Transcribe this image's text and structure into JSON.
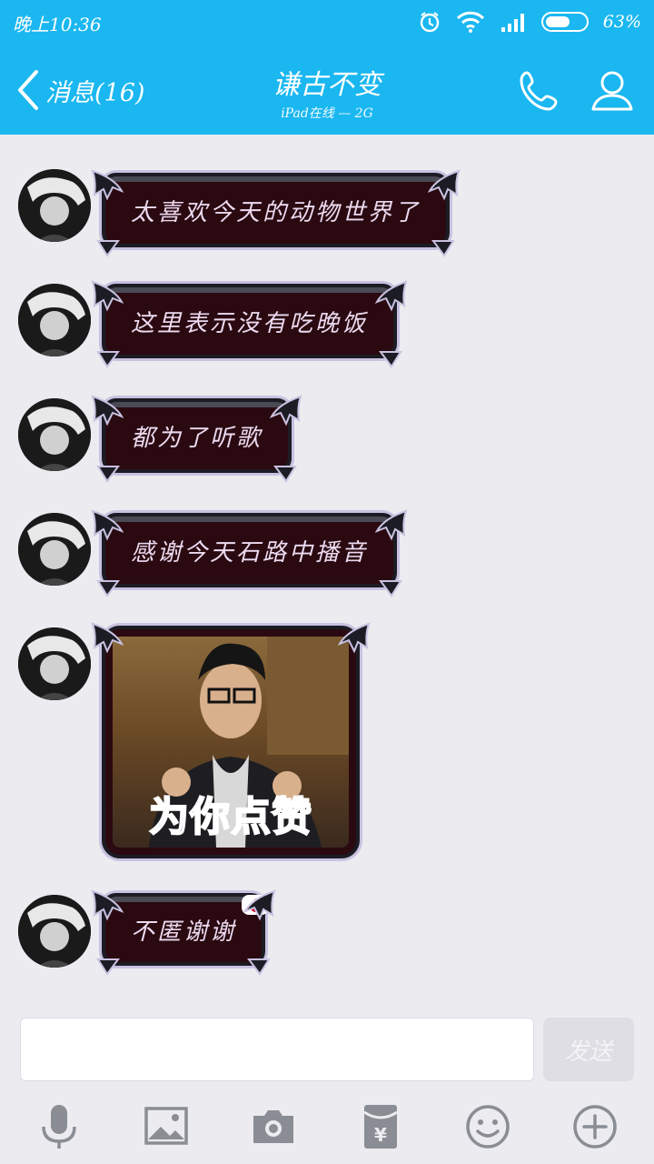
{
  "status": {
    "time": "晚上10:36",
    "battery_pct": "63%",
    "battery_level": 0.63
  },
  "nav": {
    "back_label": "消息(16)",
    "title": "谦古不变",
    "subtitle": "iPad在线 — 2G"
  },
  "messages": [
    {
      "type": "text",
      "text": "太喜欢今天的动物世界了"
    },
    {
      "type": "text",
      "text": "这里表示没有吃晚饭"
    },
    {
      "type": "text",
      "text": "都为了听歌"
    },
    {
      "type": "text",
      "text": "感谢今天石路中播音"
    },
    {
      "type": "sticker",
      "caption_main": "为你点",
      "caption_accent": "赞"
    },
    {
      "type": "text",
      "text": "不匿谢谢",
      "badge": "read-drop-icon"
    }
  ],
  "input": {
    "placeholder": "",
    "send_label": "发送"
  },
  "toolbar": [
    "mic-icon",
    "image-icon",
    "camera-icon",
    "red-packet-icon",
    "emoji-icon",
    "plus-icon"
  ],
  "colors": {
    "header": "#1ab7f0",
    "background": "#ebebf0",
    "bubble": "#2a0a10",
    "bubble_text": "#ecdaf0"
  }
}
